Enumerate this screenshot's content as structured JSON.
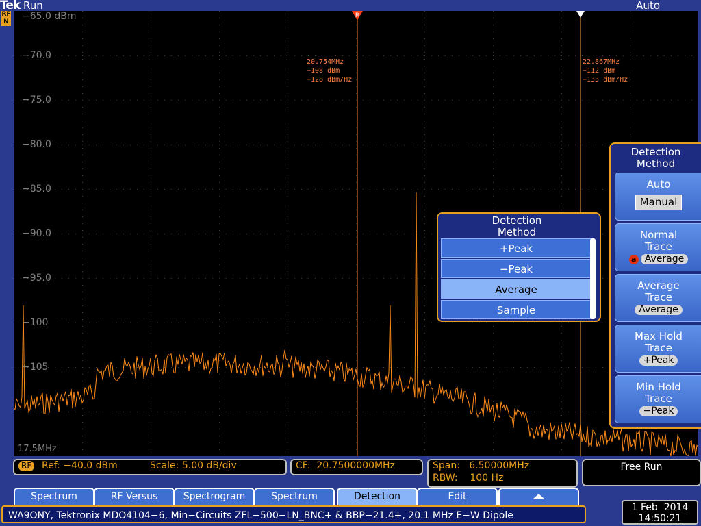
{
  "header": {
    "brand": "Tek",
    "run_state": "Run",
    "trigger_mode": "Auto",
    "rf_badge": "RF\nN"
  },
  "plot": {
    "y_labels": [
      "−65.0 dBm",
      "−70.0",
      "−75.0",
      "−80.0",
      "−85.0",
      "−90.0",
      "−95.0",
      "−100",
      "−105"
    ],
    "start_freq": "17.5MHz",
    "marker_r": {
      "label": "R",
      "lines": [
        "20.754MHz",
        "−108 dBm",
        "−128 dBm/Hz"
      ]
    },
    "marker_2": {
      "lines": [
        "22.867MHz",
        "−112 dBm",
        "−133 dBm/Hz"
      ]
    },
    "trace_color": "#ff8c1a"
  },
  "readout": {
    "rf_tag": "RF",
    "ref": "Ref: −40.0 dBm",
    "scale": "Scale: 5.00 dB/div",
    "cf": "CF:  20.7500000MHz",
    "span": "Span:   6.50000MHz",
    "rbw": "RBW:    100 Hz",
    "trigger": "Free Run"
  },
  "softkeys": [
    "Spectrum",
    "RF Versus",
    "Spectrogram",
    "Spectrum",
    "Detection",
    "Edit"
  ],
  "caption": "WA9ONY, Tektronix MDO4104−6, Min−Circuits ZFL−500−LN_BNC+ & BBP−21.4+, 20.1 MHz E−W Dipole",
  "datetime": {
    "date": "1 Feb  2014",
    "time": "14:50:21"
  },
  "side_menu": {
    "title": "Detection Method",
    "auto": "Auto",
    "manual": "Manual",
    "normal": {
      "title": "Normal Trace",
      "badge": "a",
      "value": "Average"
    },
    "average": {
      "title": "Average Trace",
      "value": "Average"
    },
    "maxhold": {
      "title": "Max Hold Trace",
      "value": "+Peak"
    },
    "minhold": {
      "title": "Min Hold Trace",
      "value": "−Peak"
    }
  },
  "popup": {
    "title": "Detection Method",
    "items": [
      "+Peak",
      "−Peak",
      "Average",
      "Sample"
    ],
    "selected": "Average"
  }
}
